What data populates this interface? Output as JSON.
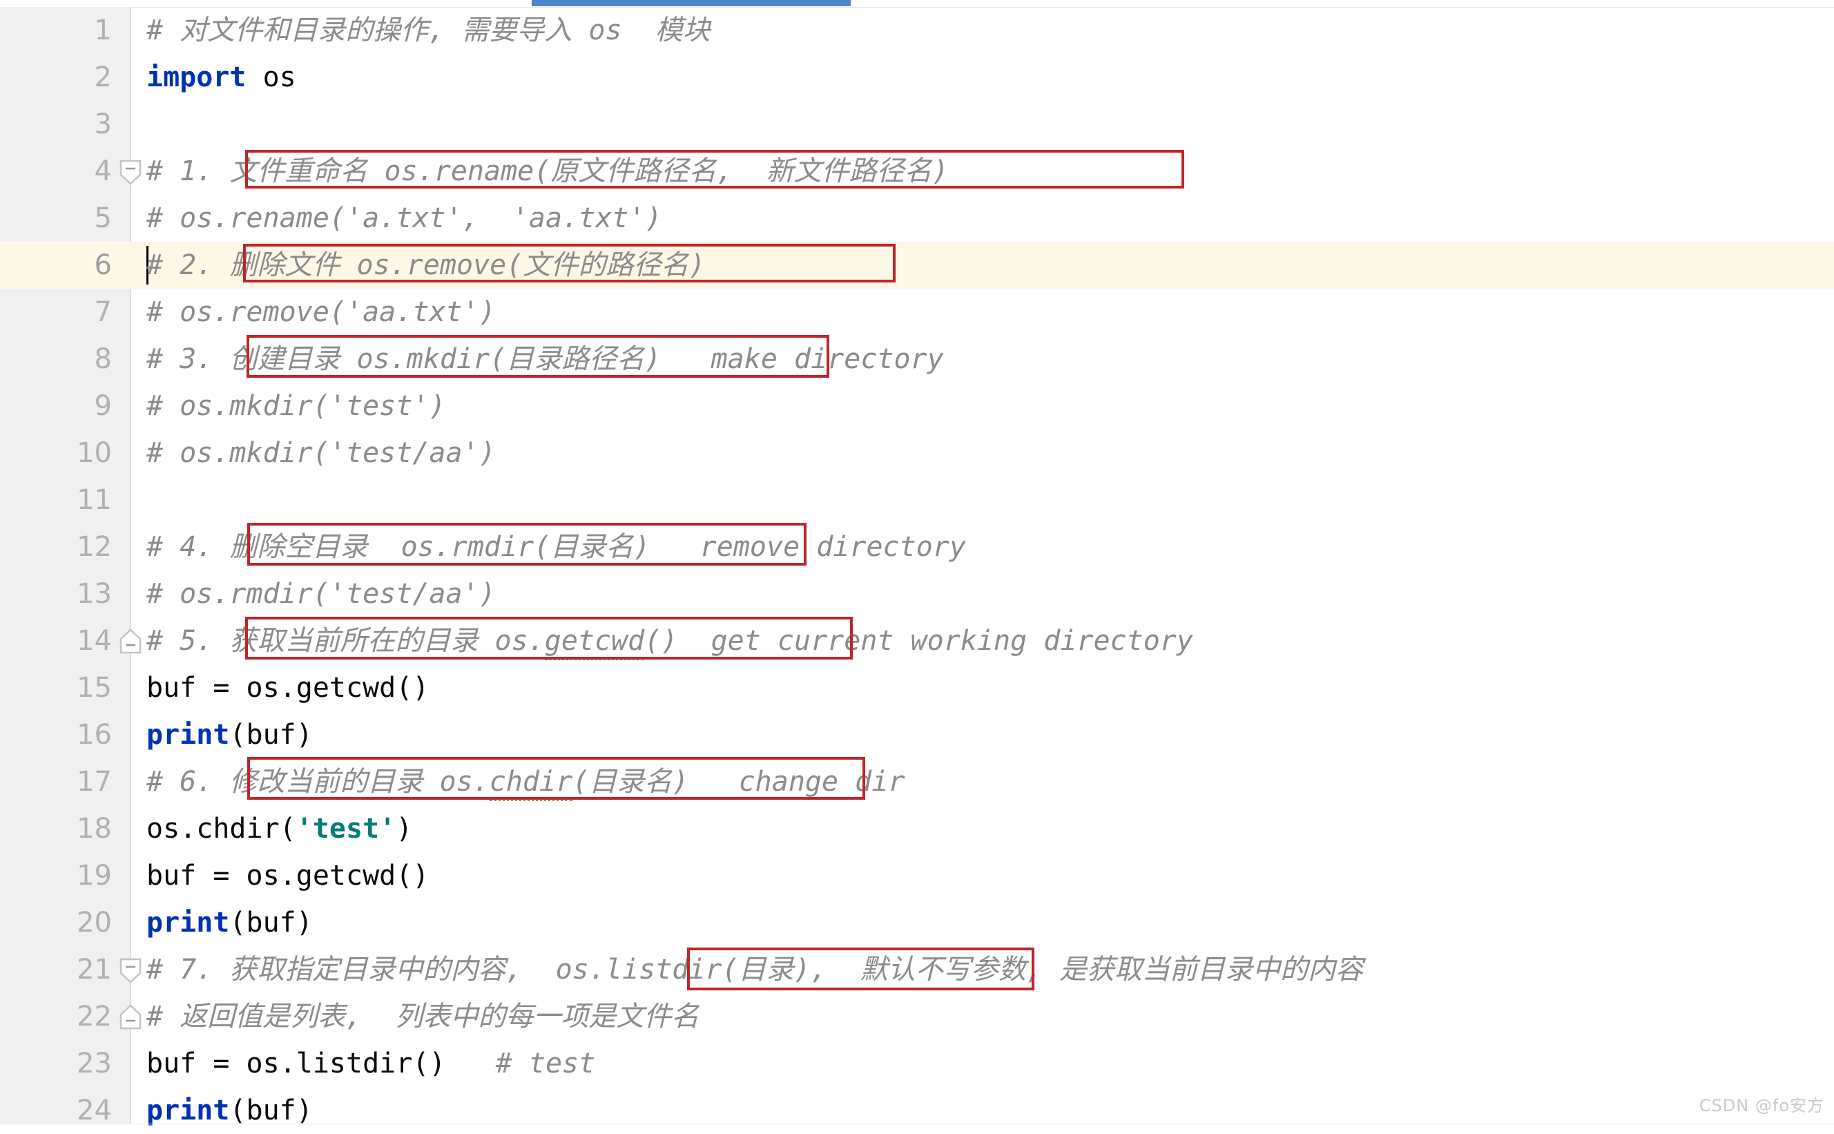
{
  "window": {
    "kind": "code-editor",
    "language": "Python",
    "watermark": "CSDN @fo安方"
  },
  "scrollbar": {
    "orientation": "horizontal",
    "thumb_color": "#4a86c8"
  },
  "colors": {
    "background": "#ffffff",
    "gutter": "#f0f0f0",
    "line_number": "#b1b1b1",
    "comment": "#8c8c8c",
    "keyword": "#0033b3",
    "string": "#067d74",
    "text": "#0a0a0a",
    "current_line_highlight": "#fdf8e6",
    "annotation_box": "#c0252a",
    "spellcheck_squiggle": "#6aa84f"
  },
  "editor": {
    "current_line": 6,
    "caret_line": 6,
    "caret_column": 1,
    "total_lines_visible": 24,
    "lines": [
      {
        "n": "1",
        "text": "# 对文件和目录的操作, 需要导入 os  模块"
      },
      {
        "n": "2",
        "text": "import os"
      },
      {
        "n": "3",
        "text": ""
      },
      {
        "n": "4",
        "text": "# 1. 文件重命名 os.rename(原文件路径名,  新文件路径名)"
      },
      {
        "n": "5",
        "text": "# os.rename('a.txt',  'aa.txt')"
      },
      {
        "n": "6",
        "text": "# 2. 删除文件 os.remove(文件的路径名)"
      },
      {
        "n": "7",
        "text": "# os.remove('aa.txt')"
      },
      {
        "n": "8",
        "text": "# 3. 创建目录 os.mkdir(目录路径名)   make directory"
      },
      {
        "n": "9",
        "text": "# os.mkdir('test')"
      },
      {
        "n": "10",
        "text": "# os.mkdir('test/aa')"
      },
      {
        "n": "11",
        "text": ""
      },
      {
        "n": "12",
        "text": "# 4. 删除空目录  os.rmdir(目录名)   remove directory"
      },
      {
        "n": "13",
        "text": "# os.rmdir('test/aa')"
      },
      {
        "n": "14",
        "text": "# 5. 获取当前所在的目录 os.getcwd()  get current working directory"
      },
      {
        "n": "15",
        "text": "buf = os.getcwd()"
      },
      {
        "n": "16",
        "text": "print(buf)"
      },
      {
        "n": "17",
        "text": "# 6. 修改当前的目录 os.chdir(目录名)   change dir"
      },
      {
        "n": "18",
        "text": "os.chdir('test')"
      },
      {
        "n": "19",
        "text": "buf = os.getcwd()"
      },
      {
        "n": "20",
        "text": "print(buf)"
      },
      {
        "n": "21",
        "text": "# 7. 获取指定目录中的内容,  os.listdir(目录),  默认不写参数, 是获取当前目录中的内容"
      },
      {
        "n": "22",
        "text": "# 返回值是列表,  列表中的每一项是文件名"
      },
      {
        "n": "23",
        "text": "buf = os.listdir()   # test"
      },
      {
        "n": "24",
        "text": "print(buf)"
      }
    ],
    "fold_markers": [
      {
        "line": 4,
        "type": "fold-start-collapsible"
      },
      {
        "line": 14,
        "type": "fold-end"
      },
      {
        "line": 21,
        "type": "fold-start-collapsible"
      },
      {
        "line": 22,
        "type": "fold-end"
      }
    ],
    "spellcheck_underlines": [
      {
        "line": 14,
        "word": "getcwd"
      },
      {
        "line": 17,
        "word": "chdir"
      }
    ]
  },
  "tokens": {
    "l1": {
      "comment": "# 对文件和目录的操作, 需要导入 os  模块"
    },
    "l2": {
      "keyword": "import",
      "module": " os"
    },
    "l4": {
      "prefix": "# 1. ",
      "boxed": "文件重命名 os.rename(原文件路径名,  新文件路径名)"
    },
    "l5": {
      "comment": "# os.rename('a.txt',  'aa.txt')"
    },
    "l6": {
      "prefix": "# 2. ",
      "boxed": "删除文件 os.remove(文件的路径名)"
    },
    "l7": {
      "comment": "# os.remove('aa.txt')"
    },
    "l8": {
      "prefix": "# 3. ",
      "boxed": "创建目录 os.mkdir(目录路径名)",
      "suffix": "   make directory"
    },
    "l9": {
      "comment": "# os.mkdir('test')"
    },
    "l10": {
      "comment": "# os.mkdir('test/aa')"
    },
    "l12": {
      "prefix": "# 4. ",
      "boxed": "删除空目录  os.rmdir(目录名)",
      "suffix": "   remove directory"
    },
    "l13": {
      "comment": "# os.rmdir('test/aa')"
    },
    "l14": {
      "prefix": "# 5. ",
      "boxed_a": "获取当前所在的目录 os.",
      "boxed_squiggle": "getcwd",
      "boxed_b": "()",
      "suffix": "  get current working directory"
    },
    "l15": {
      "var": "buf = os.getcwd()"
    },
    "l16": {
      "fn": "print",
      "args": "(buf)"
    },
    "l17": {
      "prefix": "# 6. ",
      "boxed_a": "修改当前的目录 os.",
      "boxed_squiggle": "chdir",
      "boxed_b": "(目录名)",
      "suffix": "   change dir"
    },
    "l18": {
      "a": "os.chdir(",
      "str": "'test'",
      "b": ")"
    },
    "l19": {
      "var": "buf = os.getcwd()"
    },
    "l20": {
      "fn": "print",
      "args": "(buf)"
    },
    "l21": {
      "prefix": "# 7. 获取指定目录中的内容,  ",
      "boxed": "os.listdir(目录),",
      "suffix": "  默认不写参数, 是获取当前目录中的内容"
    },
    "l22": {
      "comment": "# 返回值是列表,  列表中的每一项是文件名"
    },
    "l23": {
      "a": "buf = os.listdir()",
      "comment": "   # test"
    },
    "l24": {
      "fn": "print",
      "args": "(buf)"
    }
  },
  "annotations": [
    {
      "id": "box-rename",
      "label": "文件重命名 os.rename(原文件路径名,  新文件路径名)"
    },
    {
      "id": "box-remove",
      "label": "删除文件 os.remove(文件的路径名)"
    },
    {
      "id": "box-mkdir",
      "label": "创建目录 os.mkdir(目录路径名)"
    },
    {
      "id": "box-rmdir",
      "label": "删除空目录  os.rmdir(目录名)"
    },
    {
      "id": "box-getcwd",
      "label": "获取当前所在的目录 os.getcwd()"
    },
    {
      "id": "box-chdir",
      "label": "修改当前的目录 os.chdir(目录名)"
    },
    {
      "id": "box-listdir",
      "label": "os.listdir(目录),"
    }
  ]
}
